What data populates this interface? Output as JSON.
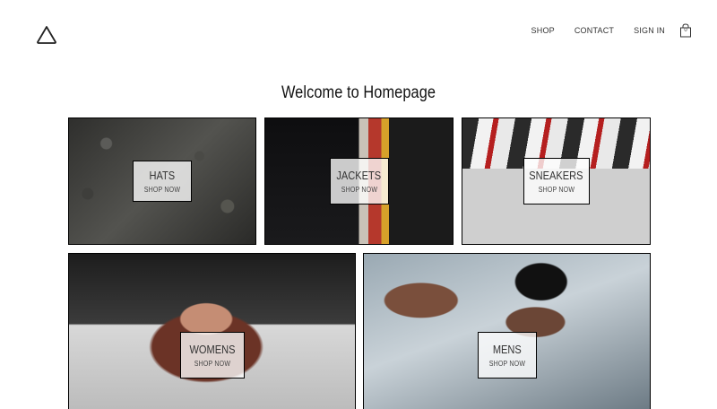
{
  "header": {
    "logo_icon": "crown-logo-icon",
    "nav": [
      "SHOP",
      "CONTACT",
      "SIGN IN"
    ],
    "cart": {
      "icon": "shopping-bag-icon",
      "count": "0"
    }
  },
  "page": {
    "title": "Welcome to Homepage"
  },
  "directory": [
    {
      "title": "HATS",
      "subtitle": "SHOP NOW"
    },
    {
      "title": "JACKETS",
      "subtitle": "SHOP NOW"
    },
    {
      "title": "SNEAKERS",
      "subtitle": "SHOP NOW"
    },
    {
      "title": "WOMENS",
      "subtitle": "SHOP NOW"
    },
    {
      "title": "MENS",
      "subtitle": "SHOP NOW"
    }
  ]
}
